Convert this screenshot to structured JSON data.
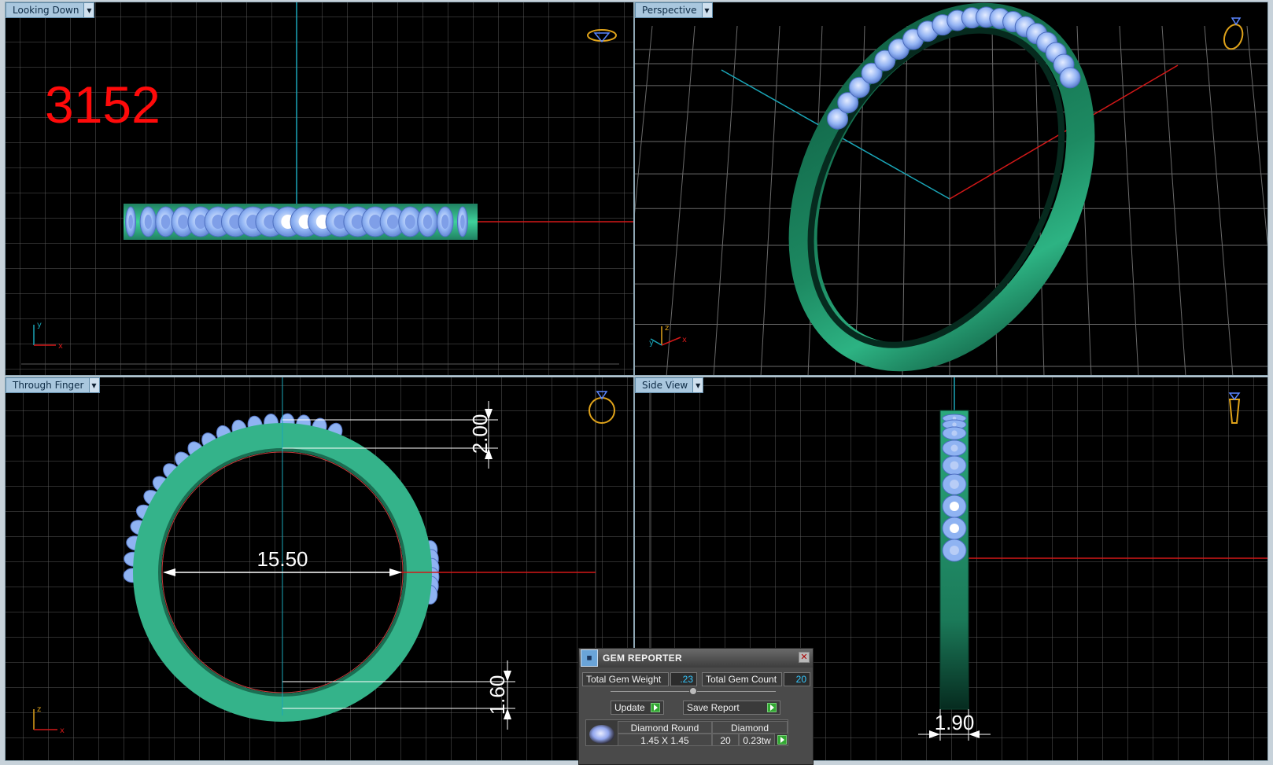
{
  "viewports": {
    "top_left": {
      "label": "Looking Down",
      "axis_x": "x",
      "axis_y": "y"
    },
    "top_right": {
      "label": "Perspective",
      "axis_x": "x",
      "axis_y": "y",
      "axis_z": "z"
    },
    "bottom_left": {
      "label": "Through Finger",
      "axis_x": "x",
      "axis_z": "z"
    },
    "bottom_right": {
      "label": "Side View"
    }
  },
  "part_number": "3152",
  "dimensions": {
    "inner_diameter": "15.50",
    "top_thickness": "2.00",
    "bottom_thickness": "1.60",
    "side_width": "1.90"
  },
  "gem_reporter": {
    "title": "GEM REPORTER",
    "app_icon": "gem-reporter-icon",
    "close_icon": "close-icon",
    "total_weight_label": "Total Gem Weight",
    "total_weight_value": ".23",
    "total_count_label": "Total Gem Count",
    "total_count_value": "20",
    "update_label": "Update",
    "save_label": "Save Report",
    "table": {
      "shape": "Diamond Round",
      "size": "1.45 X 1.45",
      "material": "Diamond",
      "count": "20",
      "weight": "0.23tw"
    }
  },
  "colors": {
    "metal": "#2f9e77",
    "gem": "#8fb3f2",
    "axis_x": "#d21818",
    "axis_y": "#1aa6b8",
    "grid": "#606060",
    "label_bg": "#a9c7de",
    "part_number": "#ff0a0a"
  }
}
